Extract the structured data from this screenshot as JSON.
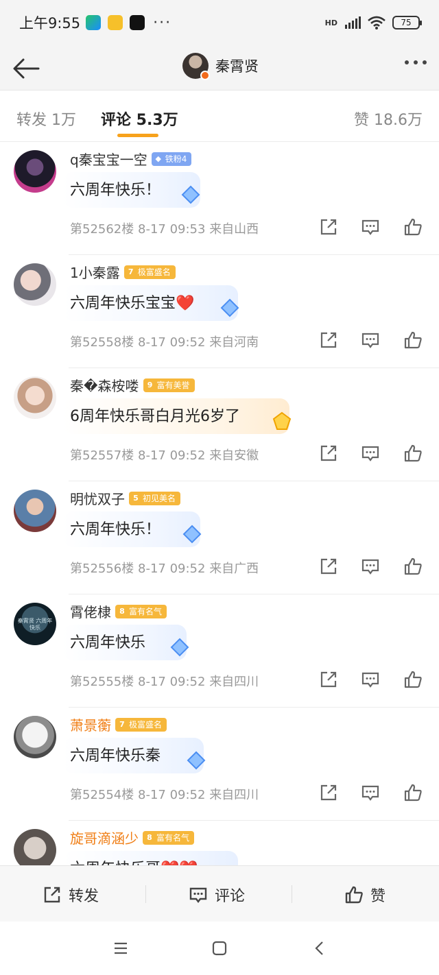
{
  "status": {
    "time": "上午9:55",
    "more": "···",
    "hd": "HD",
    "battery": "75"
  },
  "nav": {
    "title": "秦霄贤"
  },
  "tabs": {
    "repost": "转发 1万",
    "comments": "评论 5.3万",
    "likes": "赞 18.6万"
  },
  "comments": [
    {
      "name": "q秦宝宝一空",
      "badge_level": "",
      "badge_text": "铁粉4",
      "badge_style": "blue",
      "text": "六周年快乐！",
      "floor": "第52562楼",
      "time": "8-17 09:53",
      "location": "来自山西",
      "deco": "blue-diamond"
    },
    {
      "name": "1小秦露",
      "badge_level": "7",
      "badge_text": "极富盛名",
      "badge_style": "gold",
      "text": "六周年快乐宝宝❤️",
      "floor": "第52558楼",
      "time": "8-17 09:52",
      "location": "来自河南",
      "deco": "blue-diamond"
    },
    {
      "name": "秦�森桉喽",
      "badge_level": "9",
      "badge_text": "富有美誉",
      "badge_style": "gold",
      "text": "6周年快乐哥白月光6岁了",
      "floor": "第52557楼",
      "time": "8-17 09:52",
      "location": "来自安徽",
      "deco": "gold-gem"
    },
    {
      "name": "明忧双子",
      "badge_level": "5",
      "badge_text": "初见美名",
      "badge_style": "gold",
      "text": "六周年快乐！",
      "floor": "第52556楼",
      "time": "8-17 09:52",
      "location": "来自广西",
      "deco": "blue-diamond"
    },
    {
      "name": "霄佬棣",
      "badge_level": "8",
      "badge_text": "富有名气",
      "badge_style": "gold",
      "text": "六周年快乐",
      "floor": "第52555楼",
      "time": "8-17 09:52",
      "location": "来自四川",
      "deco": "blue-diamond"
    },
    {
      "name": "萧景蘅",
      "badge_level": "7",
      "badge_text": "极富盛名",
      "badge_style": "gold",
      "text": "六周年快乐秦",
      "floor": "第52554楼",
      "time": "8-17 09:52",
      "location": "来自四川",
      "deco": "blue-diamond"
    },
    {
      "name": "旋哥滴涵少",
      "badge_level": "8",
      "badge_text": "富有名气",
      "badge_style": "gold",
      "text": "六周年快乐哥❤️❤️",
      "floor": "",
      "time": "",
      "location": "",
      "deco": ""
    }
  ],
  "avatar_text": {
    "c5": "秦霄贤 六周年快乐"
  },
  "bottom_bar": {
    "repost": "转发",
    "comment": "评论",
    "like": "赞"
  },
  "colors": {
    "accent": "#f7a21c",
    "name_orange": "#f07f17",
    "badge_gold": "#f6b73b",
    "badge_blue": "#7fa6f2"
  }
}
